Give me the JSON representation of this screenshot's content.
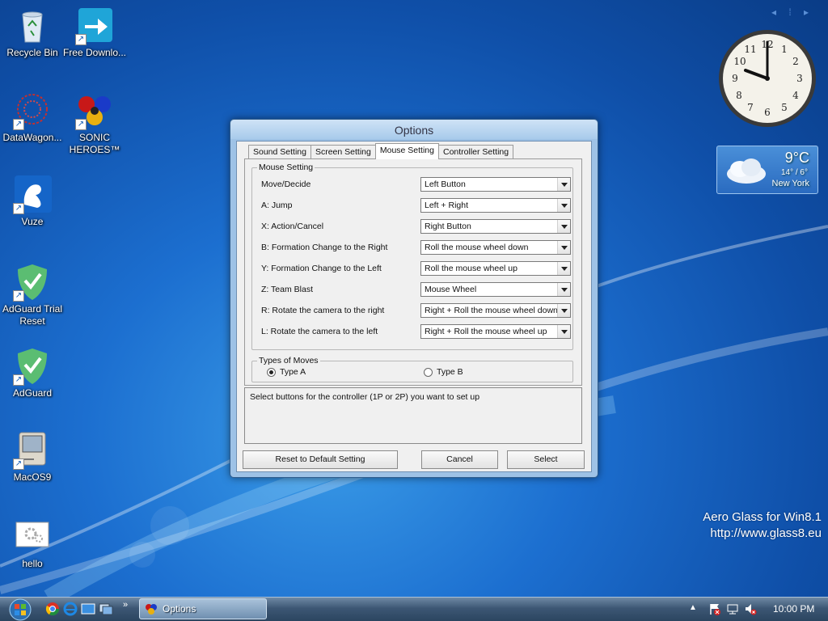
{
  "desktop": {
    "icons": [
      {
        "label": "Recycle Bin"
      },
      {
        "label": "Free Downlo..."
      },
      {
        "label": "DataWagon..."
      },
      {
        "label": "SONIC HEROES™"
      },
      {
        "label": "Vuze"
      },
      {
        "label": "AdGuard Trial Reset"
      },
      {
        "label": "AdGuard"
      },
      {
        "label": "MacOS9"
      },
      {
        "label": "hello"
      }
    ]
  },
  "gadgets": {
    "weather": {
      "temp": "9°C",
      "range": "14° / 6°",
      "city": "New York"
    },
    "nav": "◂ ⁞ ▸"
  },
  "watermark": {
    "line1": "Aero Glass for Win8.1",
    "line2": "http://www.glass8.eu"
  },
  "dialog": {
    "title": "Options",
    "tabs": [
      {
        "label": "Sound Setting"
      },
      {
        "label": "Screen Setting"
      },
      {
        "label": "Mouse Setting"
      },
      {
        "label": "Controller Setting"
      }
    ],
    "mouse_group_label": "Mouse Setting",
    "rows": [
      {
        "label": "Move/Decide",
        "value": "Left Button"
      },
      {
        "label": "A: Jump",
        "value": "Left + Right"
      },
      {
        "label": "X: Action/Cancel",
        "value": "Right Button"
      },
      {
        "label": "B: Formation Change to the Right",
        "value": "Roll the mouse wheel down"
      },
      {
        "label": "Y: Formation Change to the Left",
        "value": "Roll the mouse wheel up"
      },
      {
        "label": "Z: Team Blast",
        "value": "Mouse Wheel"
      },
      {
        "label": "R: Rotate the camera to the right",
        "value": "Right + Roll the mouse wheel down"
      },
      {
        "label": "L: Rotate the camera to the left",
        "value": "Right + Roll the mouse wheel up"
      }
    ],
    "moves_group_label": "Types of Moves",
    "type_a": "Type A",
    "type_b": "Type B",
    "description": "Select buttons for the controller (1P or 2P) you want to set up",
    "buttons": {
      "reset": "Reset to Default Setting",
      "cancel": "Cancel",
      "select": "Select"
    }
  },
  "taskbar": {
    "task_label": "Options",
    "overflow": "»",
    "time": "10:00 PM",
    "tray_up": "▲"
  },
  "colors": {
    "accent": "#1c6fd0",
    "dialog_frame": "#9ec2e6"
  }
}
